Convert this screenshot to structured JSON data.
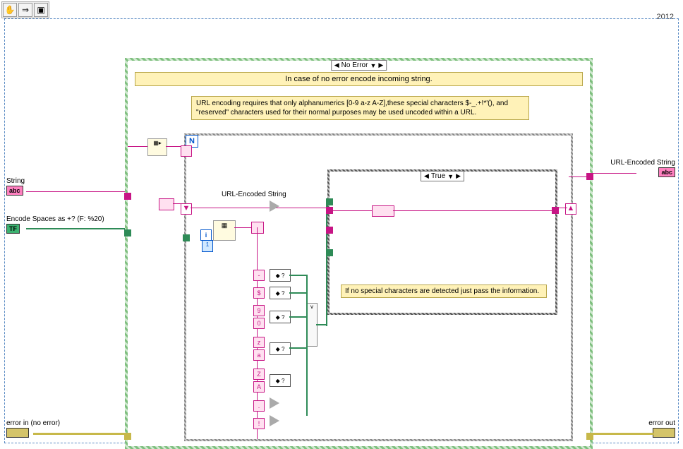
{
  "year": "2012",
  "toolbar": {
    "hand": "✋",
    "arrow": "⇒",
    "highlight": "▣"
  },
  "terminals": {
    "string_label": "String",
    "string_type": "abc",
    "encode_spaces_label": "Encode Spaces as +? (F: %20)",
    "encode_spaces_type": "TF",
    "error_in_label": "error in (no error)",
    "url_encoded_label": "URL-Encoded String",
    "url_encoded_type": "abc",
    "error_out_label": "error out"
  },
  "case_outer": {
    "selector": "No Error",
    "banner": "In case of no error encode incoming string.",
    "description": "URL encoding requires that only alphanumerics [0-9 a-z A-Z],these special characters $-_.+!*'(), and \"reserved\" characters used for their normal purposes may be used uncoded within a URL."
  },
  "for_loop": {
    "n": "N",
    "i": "i",
    "shift_init": "1",
    "wire_label": "URL-Encoded String"
  },
  "case_inner": {
    "selector": "True",
    "description": "If no special characters are detected just pass the information."
  },
  "char_constants": [
    "-",
    "$",
    "9",
    "0",
    "z",
    "a",
    "Z",
    "A",
    ".",
    "!"
  ],
  "or_label": "v"
}
